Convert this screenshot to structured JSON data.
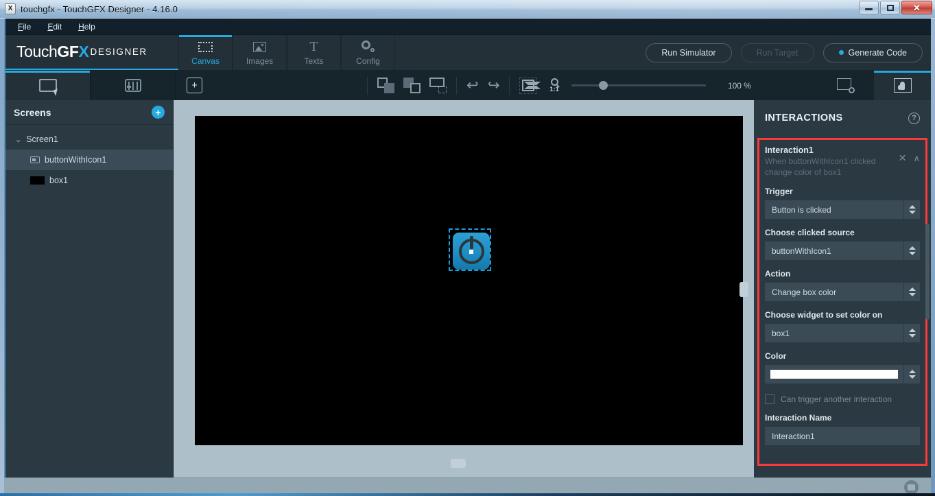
{
  "window": {
    "title": "touchgfx - TouchGFX Designer - 4.16.0",
    "app_icon": "app-icon",
    "minimize": "minimize-button",
    "maximize": "maximize-button",
    "close": "close-button"
  },
  "menu": {
    "items": [
      {
        "label": "File"
      },
      {
        "label": "Edit"
      },
      {
        "label": "Help"
      }
    ]
  },
  "brand": {
    "logo_part1": "Touch",
    "logo_part2": "GF",
    "logo_part3": "X",
    "logo_sub": "DESIGNER"
  },
  "main_tabs": [
    {
      "label": "Canvas",
      "icon": "dotted-rectangle-icon",
      "active": true
    },
    {
      "label": "Images",
      "icon": "image-icon",
      "active": false
    },
    {
      "label": "Texts",
      "icon": "text-t-icon",
      "active": false
    },
    {
      "label": "Config",
      "icon": "gear-icon",
      "active": false
    }
  ],
  "header_actions": {
    "run_simulator": "Run Simulator",
    "run_target": "Run Target",
    "generate_code": "Generate Code"
  },
  "toolbar": {
    "select_tool": "select-tool",
    "widgets_tool": "widgets-tool",
    "add_widget": "+",
    "bring_front": "bring-to-front",
    "send_back": "send-to-back",
    "align_tool": "align-tool",
    "undo": "undo",
    "redo": "redo",
    "fit_screen": "fit-to-screen",
    "zoom_one_to_one_top": "1:1",
    "zoom_value": "100 %",
    "screen_settings": "screen-settings",
    "interaction_mode": "interaction-mode"
  },
  "left_panel": {
    "title": "Screens",
    "add_button": "+",
    "tree": [
      {
        "label": "Screen1",
        "icon": "chevron-down-icon",
        "selected": false,
        "level": 0
      },
      {
        "label": "buttonWithIcon1",
        "icon": "button-widget-icon",
        "selected": true,
        "level": 1
      },
      {
        "label": "box1",
        "icon": "box-widget-icon",
        "selected": false,
        "level": 1
      }
    ]
  },
  "canvas": {
    "widget_name": "buttonWithIcon1",
    "widget_icon": "power-button-icon",
    "background_color": "#000000",
    "selection_color": "#1f9ad6"
  },
  "right_panel": {
    "title": "INTERACTIONS",
    "help": "?",
    "interaction": {
      "name_heading": "Interaction1",
      "description_line1": "When buttonWithIcon1 clicked",
      "description_line2": "change color of box1",
      "close_icon": "✕",
      "collapse_icon": "∧",
      "trigger_label": "Trigger",
      "trigger_value": "Button is clicked",
      "source_label": "Choose clicked source",
      "source_value": "buttonWithIcon1",
      "action_label": "Action",
      "action_value": "Change box color",
      "widget_label": "Choose widget to set color on",
      "widget_value": "box1",
      "color_label": "Color",
      "color_value": "#FFFFFF",
      "can_trigger_label": "Can trigger another interaction",
      "can_trigger_checked": false,
      "interaction_name_label": "Interaction Name",
      "interaction_name_value": "Interaction1"
    },
    "highlight_color": "#FB3B3B"
  },
  "status_bar": {
    "disk_icon": "save-status-icon"
  }
}
